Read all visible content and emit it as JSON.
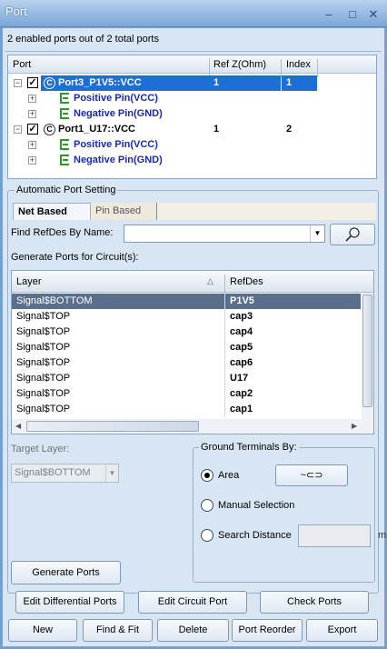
{
  "window": {
    "title": "Port",
    "minimize": "–",
    "restore": "□",
    "close": "✕"
  },
  "summary": "2 enabled ports out of 2 total ports",
  "tree": {
    "headers": [
      "Port",
      "Ref Z(Ohm)",
      "Index"
    ],
    "rows": [
      {
        "label": "Port3_P1V5::VCC",
        "ref": "1",
        "index": "1",
        "selected": true
      },
      {
        "label": "Positive Pin(VCC)"
      },
      {
        "label": "Negative Pin(GND)"
      },
      {
        "label": "Port1_U17::VCC",
        "ref": "1",
        "index": "2"
      },
      {
        "label": "Positive Pin(VCC)"
      },
      {
        "label": "Negative Pin(GND)"
      }
    ]
  },
  "auto": {
    "group_label": "Automatic Port Setting",
    "tabs": [
      "Net Based",
      "Pin Based"
    ],
    "find_label": "Find RefDes By Name:",
    "find_value": "",
    "generate_for_label": "Generate Ports for Circuit(s):",
    "grid": {
      "headers": [
        "Layer",
        "RefDes"
      ],
      "rows": [
        [
          "Signal$BOTTOM",
          "P1V5"
        ],
        [
          "Signal$TOP",
          "cap3"
        ],
        [
          "Signal$TOP",
          "cap4"
        ],
        [
          "Signal$TOP",
          "cap5"
        ],
        [
          "Signal$TOP",
          "cap6"
        ],
        [
          "Signal$TOP",
          "U17"
        ],
        [
          "Signal$TOP",
          "cap2"
        ],
        [
          "Signal$TOP",
          "cap1"
        ]
      ]
    },
    "target_layer_label": "Target Layer:",
    "target_layer_value": "Signal$BOTTOM",
    "ground": {
      "group_label": "Ground Terminals By:",
      "area": "Area",
      "area_button": "~⊂⊃",
      "manual": "Manual Selection",
      "search": "Search Distance",
      "search_unit": "m"
    },
    "generate_button": "Generate Ports"
  },
  "buttons": {
    "edit_diff": "Edit Differential Ports",
    "edit_circuit": "Edit Circuit Port",
    "check": "Check Ports",
    "new": "New",
    "find_fit": "Find & Fit",
    "delete": "Delete",
    "reorder": "Port Reorder",
    "export": "Export"
  },
  "colors": {
    "selection": "#1c6fd6",
    "grid_selection": "#5a6f8c",
    "tree_text": "#1a2ab0",
    "pin_icon": "#2a9a2a"
  }
}
